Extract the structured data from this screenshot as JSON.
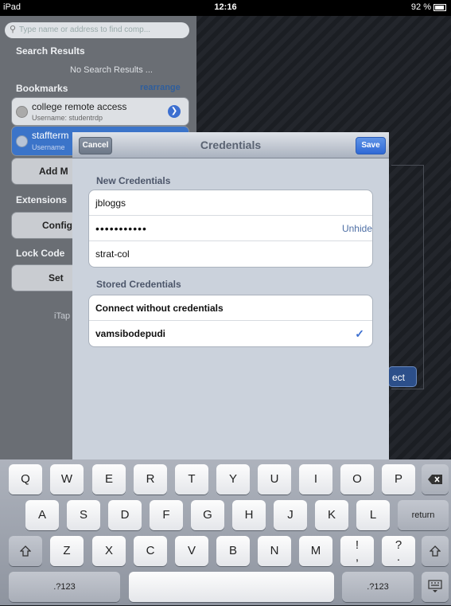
{
  "status_bar": {
    "device": "iPad",
    "time": "12:16",
    "battery": "92 %"
  },
  "sidebar": {
    "search_placeholder": "Type name or address to find comp...",
    "search_results_heading": "Search Results",
    "no_results": "No Search Results ...",
    "bookmarks_heading": "Bookmarks",
    "rearrange": "rearrange",
    "bookmarks": [
      {
        "name": "college remote access",
        "username": "Username: studentrdp"
      },
      {
        "name": "staffterm",
        "username": "Username"
      }
    ],
    "add_button": "Add M",
    "extensions_heading": "Extensions",
    "config_button": "Config",
    "lock_code_heading": "Lock Code",
    "set_button": "Set",
    "footer": "iTap"
  },
  "background": {
    "connect_label": "ect"
  },
  "modal": {
    "title": "Credentials",
    "cancel": "Cancel",
    "save": "Save",
    "new_credentials_heading": "New Credentials",
    "username": "jbloggs",
    "password": "•••••••••••",
    "unhide": "Unhide",
    "domain": "strat-col",
    "stored_credentials_heading": "Stored Credentials",
    "stored": [
      {
        "label": "Connect without credentials",
        "checked": false
      },
      {
        "label": "vamsibodepudi",
        "checked": true
      }
    ],
    "checkmark": "✓"
  },
  "keyboard": {
    "row1": [
      "Q",
      "W",
      "E",
      "R",
      "T",
      "Y",
      "U",
      "I",
      "O",
      "P"
    ],
    "row2": [
      "A",
      "S",
      "D",
      "F",
      "G",
      "H",
      "J",
      "K",
      "L"
    ],
    "row3": [
      "Z",
      "X",
      "C",
      "V",
      "B",
      "N",
      "M"
    ],
    "return_label": "return",
    "numbers_label": ".?123",
    "punct1": "!\n,",
    "punct2": "?\n."
  }
}
